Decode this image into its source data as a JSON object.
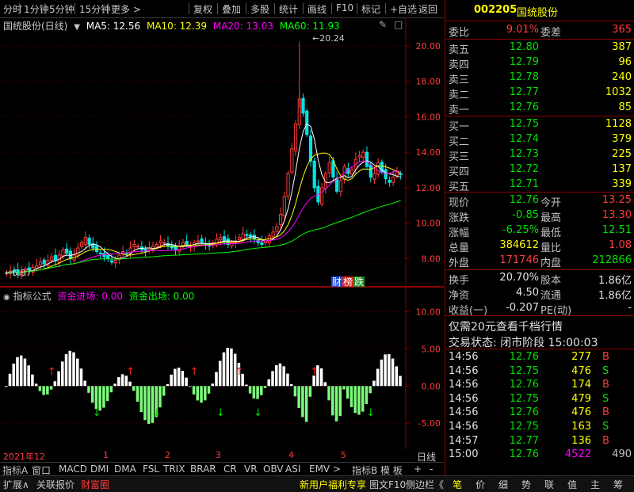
{
  "toolbar": {
    "items": [
      "分时",
      "1分钟",
      "5分钟",
      "15分钟",
      "更多 >",
      "复权",
      "叠加",
      "多股",
      "统计",
      "画线",
      "F10",
      "标记",
      "+自选",
      "返回"
    ]
  },
  "chart_header": {
    "stock_label": "国统股份(日线)",
    "ma5": "MA5: 12.56",
    "ma10": "MA10: 12.39",
    "ma20": "MA20: 13.03",
    "ma60": "MA60: 11.93",
    "high_mark": "20.24",
    "low_mark": "6.87",
    "badges": [
      "财",
      "榜",
      "跌"
    ]
  },
  "indicator_header": {
    "name": "指标公式",
    "in_label": "资金进场: 0.00",
    "out_label": "资金出场: 0.00"
  },
  "date_axis": {
    "labels": [
      "2021年12",
      "1",
      "2",
      "3",
      "4",
      "5"
    ],
    "period": "日线"
  },
  "indicator_tabs": {
    "items": [
      "指标A",
      "窗口",
      "MACD",
      "DMI",
      "DMA",
      "FSL",
      "TRIX",
      "BRAR",
      "CR",
      "VR",
      "OBV",
      "ASI",
      "EMV",
      ">",
      "指标B",
      "模 板",
      "+",
      "-"
    ]
  },
  "status_bar": {
    "left": [
      "扩展∧",
      "关联报价",
      "财富圈"
    ],
    "right": [
      "新用户福利专享",
      "图文F10",
      "侧边栏《"
    ],
    "nav": [
      "笔",
      "价",
      "细",
      "势",
      "联",
      "值",
      "主",
      "筹"
    ]
  },
  "quote": {
    "code": "002205",
    "name": "国统股份",
    "webi_label": "委比",
    "webi_value": "9.01%",
    "weicha_label": "委差",
    "weicha_value": "365",
    "asks": [
      {
        "label": "卖五",
        "price": "12.80",
        "vol": "387"
      },
      {
        "label": "卖四",
        "price": "12.79",
        "vol": "96"
      },
      {
        "label": "卖三",
        "price": "12.78",
        "vol": "240"
      },
      {
        "label": "卖二",
        "price": "12.77",
        "vol": "1032"
      },
      {
        "label": "卖一",
        "price": "12.76",
        "vol": "85"
      }
    ],
    "bids": [
      {
        "label": "买一",
        "price": "12.75",
        "vol": "1128"
      },
      {
        "label": "买二",
        "price": "12.74",
        "vol": "379"
      },
      {
        "label": "买三",
        "price": "12.73",
        "vol": "225"
      },
      {
        "label": "买四",
        "price": "12.72",
        "vol": "137"
      },
      {
        "label": "买五",
        "price": "12.71",
        "vol": "339"
      }
    ],
    "stats": [
      {
        "l1": "现价",
        "v1": "12.76",
        "c1": "green",
        "l2": "今开",
        "v2": "13.25",
        "c2": "red"
      },
      {
        "l1": "涨跌",
        "v1": "-0.85",
        "c1": "green",
        "l2": "最高",
        "v2": "13.30",
        "c2": "red"
      },
      {
        "l1": "涨幅",
        "v1": "-6.25%",
        "c1": "green",
        "l2": "最低",
        "v2": "12.51",
        "c2": "green"
      },
      {
        "l1": "总量",
        "v1": "384612",
        "c1": "yellow",
        "l2": "量比",
        "v2": "1.08",
        "c2": "red"
      },
      {
        "l1": "外盘",
        "v1": "171746",
        "c1": "red",
        "l2": "内盘",
        "v2": "212866",
        "c2": "green"
      }
    ],
    "stats2": [
      {
        "l1": "换手",
        "v1": "20.70%",
        "l2": "股本",
        "v2": "1.86亿"
      },
      {
        "l1": "净资",
        "v1": "4.50",
        "l2": "流通",
        "v2": "1.86亿"
      },
      {
        "l1": "收益(一)",
        "v1": "-0.207",
        "l2": "PE(动)",
        "v2": "-"
      }
    ],
    "promo": "仅需20元查看千档行情",
    "trade_status": "交易状态: 闭市阶段 15:00:03",
    "ticks": [
      {
        "time": "14:56",
        "price": "12.76",
        "vol": "277",
        "side": "B"
      },
      {
        "time": "14:56",
        "price": "12.75",
        "vol": "476",
        "side": "S"
      },
      {
        "time": "14:56",
        "price": "12.76",
        "vol": "174",
        "side": "B"
      },
      {
        "time": "14:56",
        "price": "12.75",
        "vol": "479",
        "side": "S"
      },
      {
        "time": "14:56",
        "price": "12.76",
        "vol": "476",
        "side": "B"
      },
      {
        "time": "14:56",
        "price": "12.75",
        "vol": "163",
        "side": "S"
      },
      {
        "time": "14:57",
        "price": "12.77",
        "vol": "136",
        "side": "B"
      },
      {
        "time": "15:00",
        "price": "12.76",
        "vol": "4522",
        "side": "490"
      }
    ]
  },
  "chart_data": [
    {
      "type": "candlestick",
      "title": "国统股份(日线)",
      "y_ticks": [
        "20.00",
        "18.00",
        "16.00",
        "14.00",
        "12.00",
        "10.00",
        "8.00"
      ],
      "ylim": [
        6.5,
        20.8
      ],
      "high": 20.24,
      "low": 6.87,
      "closes": [
        7.2,
        7.3,
        7.25,
        7.1,
        7.3,
        7.4,
        7.35,
        7.5,
        7.6,
        7.8,
        7.7,
        7.9,
        8.1,
        7.9,
        8.2,
        8.5,
        8.3,
        8.0,
        8.2,
        8.6,
        8.9,
        9.2,
        8.8,
        8.6,
        8.4,
        8.3,
        8.1,
        8.0,
        7.8,
        7.9,
        8.2,
        8.4,
        8.3,
        8.6,
        8.8,
        8.7,
        8.5,
        8.4,
        8.6,
        8.7,
        8.8,
        9.0,
        8.9,
        8.7,
        8.6,
        8.5,
        8.7,
        8.9,
        8.8,
        8.7,
        8.9,
        9.0,
        8.9,
        8.8,
        8.7,
        8.9,
        9.1,
        9.2,
        9.0,
        8.8,
        8.9,
        9.0,
        9.2,
        9.4,
        9.3,
        9.2,
        9.1,
        8.9,
        8.8,
        9.0,
        9.3,
        9.5,
        9.8,
        10.5,
        11.5,
        12.8,
        14.2,
        15.6,
        17.0,
        16.2,
        15.0,
        13.5,
        12.0,
        11.2,
        12.0,
        12.8,
        13.4,
        12.6,
        11.8,
        12.4,
        13.2,
        12.8,
        13.0,
        13.6,
        13.8,
        14.0,
        13.2,
        12.6,
        12.8,
        13.4,
        12.9,
        12.5,
        12.3,
        12.6,
        12.9,
        12.76
      ]
    },
    {
      "type": "bar",
      "title": "指标公式",
      "y_ticks": [
        "10.00",
        "5.00",
        "0.00",
        "-5.00"
      ],
      "ylim": [
        -8.5,
        12.5
      ]
    }
  ]
}
